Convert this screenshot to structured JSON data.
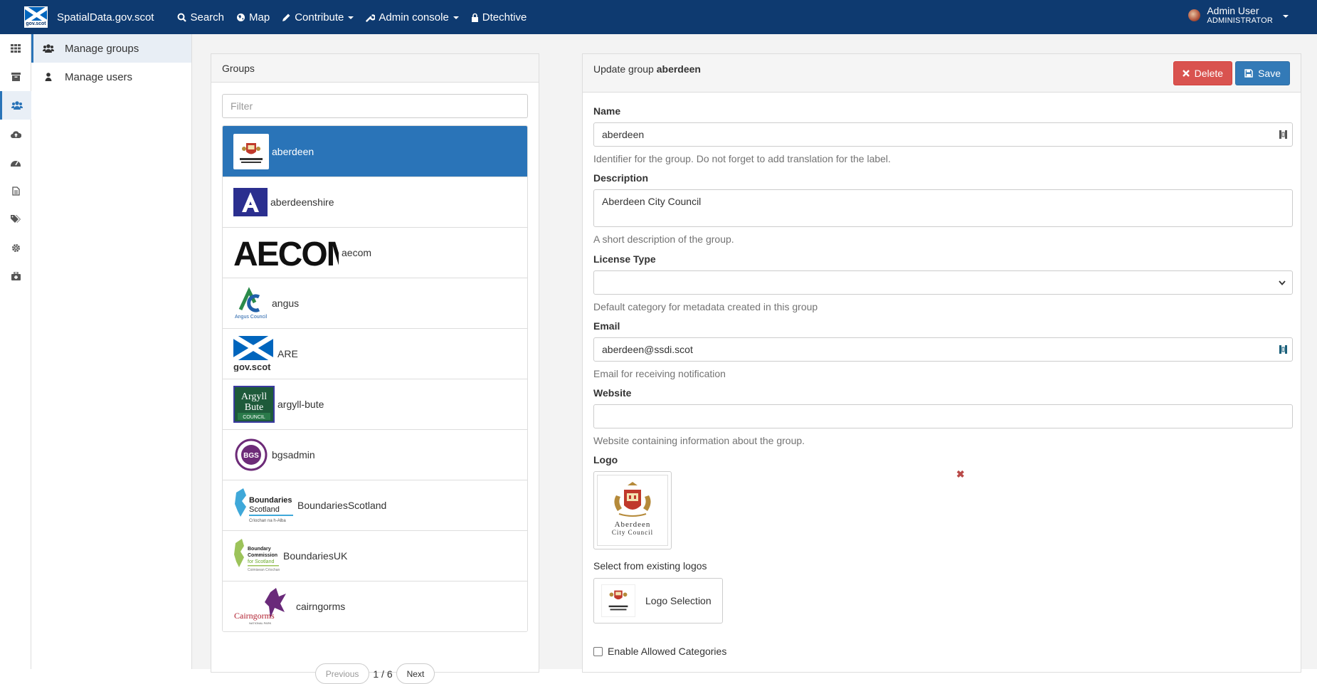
{
  "topbar": {
    "brand": "SpatialData.gov.scot",
    "brand_logo_text": "gov.scot",
    "nav": [
      {
        "label": "Search",
        "icon": "search-icon",
        "has_caret": false
      },
      {
        "label": "Map",
        "icon": "globe-icon",
        "has_caret": false
      },
      {
        "label": "Contribute",
        "icon": "pencil-icon",
        "has_caret": true
      },
      {
        "label": "Admin console",
        "icon": "wrench-icon",
        "has_caret": true
      },
      {
        "label": "Dtechtive",
        "icon": "lock-icon",
        "has_caret": false
      }
    ],
    "user": {
      "name": "Admin User",
      "role": "ADMINISTRATOR"
    }
  },
  "rail": [
    {
      "icon": "dashboard-grid-icon"
    },
    {
      "icon": "archive-icon"
    },
    {
      "icon": "users-icon",
      "active": true
    },
    {
      "icon": "cloud-upload-icon"
    },
    {
      "icon": "tachometer-icon"
    },
    {
      "icon": "file-text-icon"
    },
    {
      "icon": "tags-icon"
    },
    {
      "icon": "cog-icon"
    },
    {
      "icon": "medkit-icon"
    }
  ],
  "subnav": [
    {
      "label": "Manage groups",
      "icon": "users-icon",
      "active": true
    },
    {
      "label": "Manage users",
      "icon": "user-icon",
      "active": false
    }
  ],
  "groups": {
    "title": "Groups",
    "filter_placeholder": "Filter",
    "items": [
      {
        "label": "aberdeen",
        "logo": "aberdeen-crest-logo",
        "active": true
      },
      {
        "label": "aberdeenshire",
        "logo": "aberdeenshire-logo"
      },
      {
        "label": "aecom",
        "logo": "aecom-logo",
        "logo_text": "AECOM"
      },
      {
        "label": "angus",
        "logo": "angus-council-logo",
        "logo_text": "Angus Council"
      },
      {
        "label": "ARE",
        "logo": "gov-scot-logo",
        "logo_text": "gov.scot"
      },
      {
        "label": "argyll-bute",
        "logo": "argyll-bute-logo",
        "logo_text": "Argyll Bute COUNCIL"
      },
      {
        "label": "bgsadmin",
        "logo": "bgs-logo",
        "logo_text": "BGS"
      },
      {
        "label": "BoundariesScotland",
        "logo": "boundaries-scotland-logo",
        "logo_text": "Boundaries Scotland"
      },
      {
        "label": "BoundariesUK",
        "logo": "boundary-commission-logo",
        "logo_text": "Boundary Commission for Scotland"
      },
      {
        "label": "cairngorms",
        "logo": "cairngorms-logo",
        "logo_text": "Cairngorms"
      }
    ],
    "pager": {
      "previous": "Previous",
      "info": "1 / 6",
      "next": "Next"
    }
  },
  "form": {
    "header_prefix": "Update group",
    "header_name": "aberdeen",
    "delete_label": "Delete",
    "save_label": "Save",
    "name": {
      "label": "Name",
      "value": "aberdeen",
      "help": "Identifier for the group. Do not forget to add translation for the label."
    },
    "description": {
      "label": "Description",
      "value": "Aberdeen City Council",
      "help": "A short description of the group."
    },
    "license": {
      "label": "License Type",
      "value": "",
      "help": "Default category for metadata created in this group"
    },
    "email": {
      "label": "Email",
      "value": "aberdeen@ssdi.scot",
      "help": "Email for receiving notification"
    },
    "website": {
      "label": "Website",
      "value": "",
      "help": "Website containing information about the group."
    },
    "logo": {
      "label": "Logo",
      "crest_text_1": "Aberdeen",
      "crest_text_2": "City Council"
    },
    "existing_logos": {
      "label": "Select from existing logos",
      "button": "Logo Selection"
    },
    "allowed_categories": {
      "label": "Enable Allowed Categories"
    }
  },
  "colors": {
    "topbar": "#0e3a70",
    "active": "#2a74b8",
    "danger": "#d9534f",
    "primary": "#337ab7"
  }
}
